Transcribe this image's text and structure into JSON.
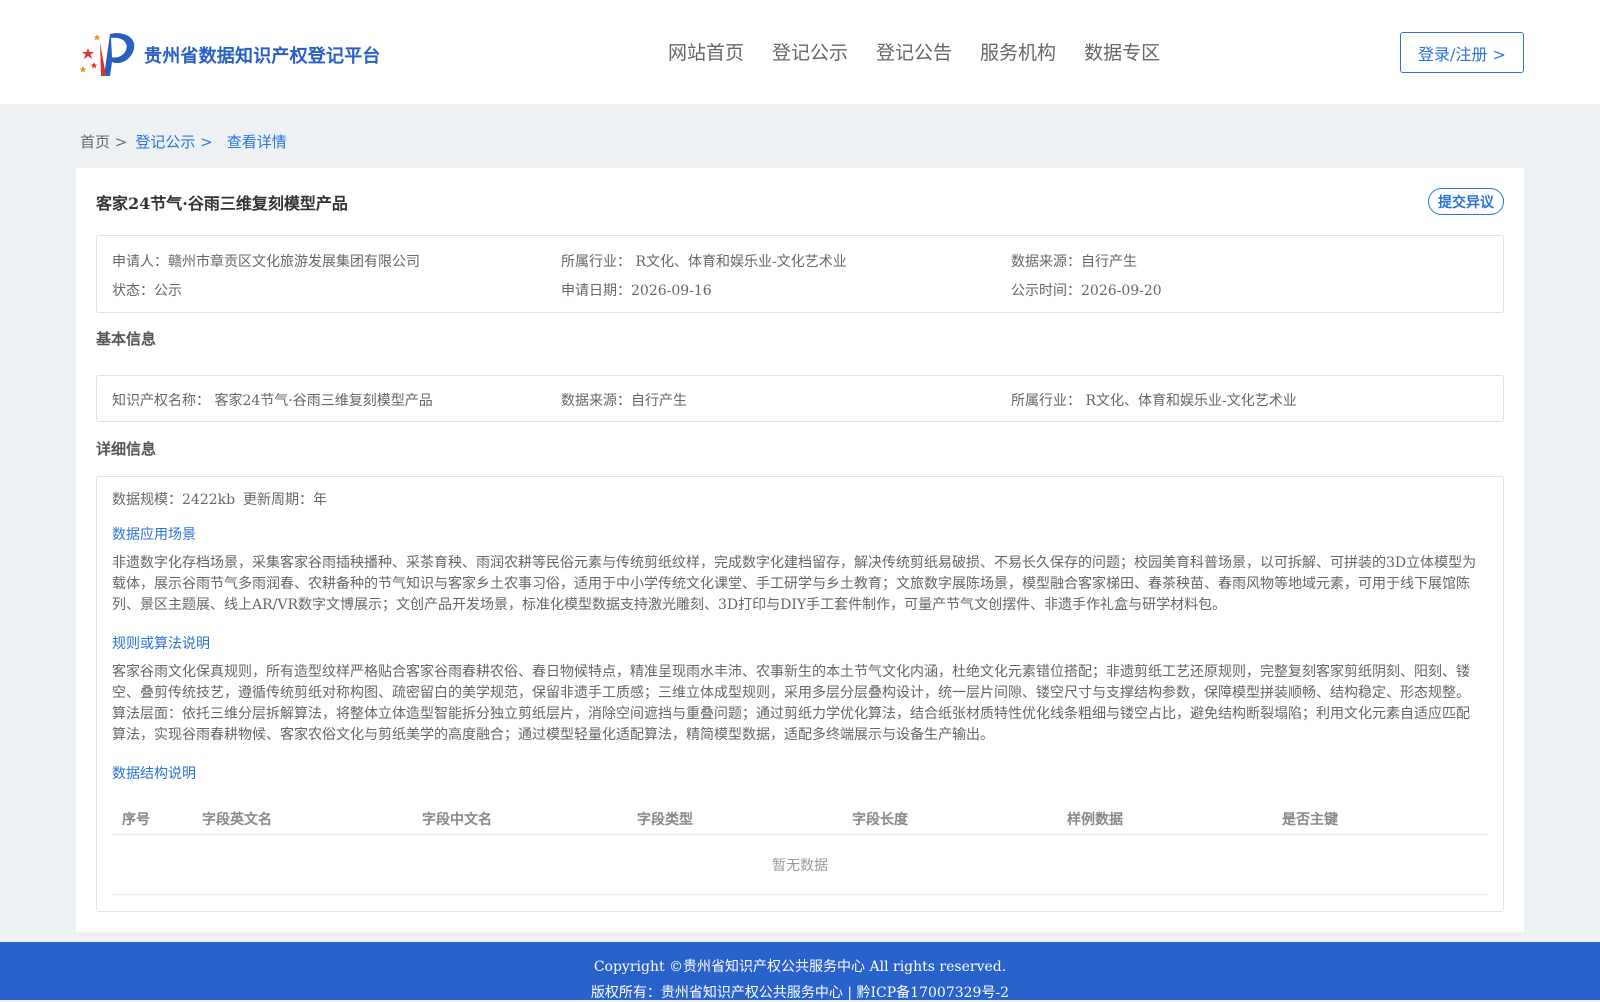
{
  "header": {
    "site_name": "贵州省数据知识产权登记平台",
    "nav": [
      "网站首页",
      "登记公示",
      "登记公告",
      "服务机构",
      "数据专区"
    ],
    "login_label": "登录/注册 >"
  },
  "breadcrumb": {
    "home": "首页 >",
    "level1": "登记公示 >",
    "current": "查看详情"
  },
  "detail": {
    "title": "客家24节气·谷雨三维复刻模型产品",
    "objection_label": "提交异议",
    "summary": {
      "applicant": "申请人：赣州市章贡区文化旅游发展集团有限公司",
      "industry": "所属行业： R文化、体育和娱乐业-文化艺术业",
      "source": "数据来源：自行产生",
      "status": "状态：公示",
      "apply_date": "申请日期：2026-09-16",
      "publish_time": "公示时间：2026-09-20"
    },
    "basic_title": "基本信息",
    "basic": {
      "ip_name": "知识产权名称： 客家24节气·谷雨三维复刻模型产品",
      "source": "数据来源：自行产生",
      "industry": "所属行业： R文化、体育和娱乐业-文化艺术业"
    },
    "detail_title": "详细信息",
    "scale": "数据规模：2422kb",
    "cycle": "更新周期：年",
    "scenario_head": "数据应用场景",
    "scenario_text": "非遗数字化存档场景，采集客家谷雨插秧播种、采茶育秧、雨润农耕等民俗元素与传统剪纸纹样，完成数字化建档留存，解决传统剪纸易破损、不易长久保存的问题；校园美育科普场景，以可拆解、可拼装的3D立体模型为载体，展示谷雨节气多雨润春、农耕备种的节气知识与客家乡土农事习俗，适用于中小学传统文化课堂、手工研学与乡土教育；文旅数字展陈场景，模型融合客家梯田、春茶秧苗、春雨风物等地域元素，可用于线下展馆陈列、景区主题展、线上AR/VR数字文博展示；文创产品开发场景，标准化模型数据支持激光雕刻、3D打印与DIY手工套件制作，可量产节气文创摆件、非遗手作礼盒与研学材料包。",
    "rule_head": "规则或算法说明",
    "rule_text": "客家谷雨文化保真规则，所有造型纹样严格贴合客家谷雨春耕农俗、春日物候特点，精准呈现雨水丰沛、农事新生的本土节气文化内涵，杜绝文化元素错位搭配；非遗剪纸工艺还原规则，完整复刻客家剪纸阴刻、阳刻、镂空、叠剪传统技艺，遵循传统剪纸对称构图、疏密留白的美学规范，保留非遗手工质感；三维立体成型规则，采用多层分层叠构设计，统一层片间隙、镂空尺寸与支撑结构参数，保障模型拼装顺畅、结构稳定、形态规整。算法层面：依托三维分层拆解算法，将整体立体造型智能拆分独立剪纸层片，消除空间遮挡与重叠问题；通过剪纸力学优化算法，结合纸张材质特性优化线条粗细与镂空占比，避免结构断裂塌陷；利用文化元素自适应匹配算法，实现谷雨春耕物候、客家农俗文化与剪纸美学的高度融合；通过模型轻量化适配算法，精简模型数据，适配多终端展示与设备生产输出。",
    "structure_head": "数据结构说明",
    "table_headers": [
      "序号",
      "字段英文名",
      "字段中文名",
      "字段类型",
      "字段长度",
      "样例数据",
      "是否主键"
    ],
    "empty_text": "暂无数据"
  },
  "footer": {
    "copyright": "Copyright ©贵州省知识产权公共服务中心 All rights reserved.",
    "owner": "版权所有：贵州省知识产权公共服务中心 | 黔ICP备17007329号-2"
  },
  "colors": {
    "brand": "#2a5fc2",
    "link": "#2a73d9",
    "footer_bg": "#2a62cc",
    "page_bg": "#eef1f4"
  }
}
